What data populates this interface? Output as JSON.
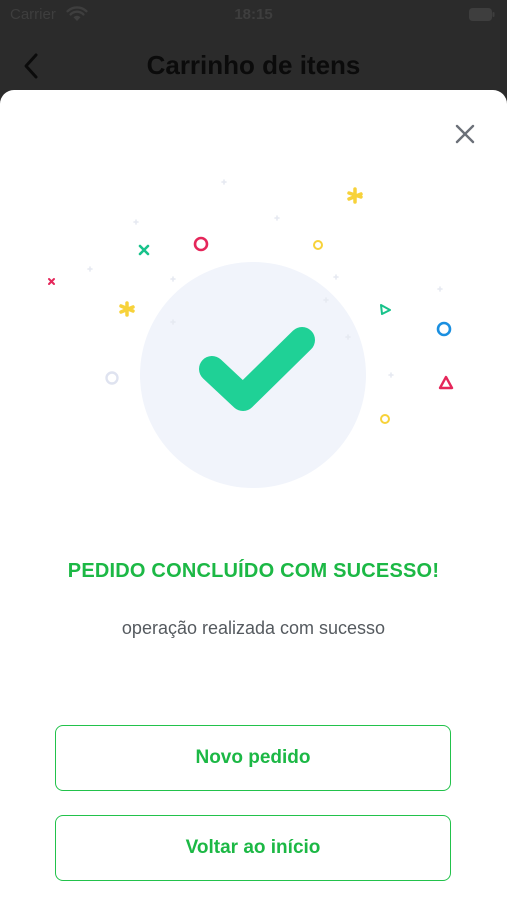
{
  "status_bar": {
    "carrier": "Carrier",
    "time": "18:15"
  },
  "nav": {
    "title": "Carrinho de itens"
  },
  "modal": {
    "title": "PEDIDO CONCLUÍDO COM SUCESSO!",
    "subtitle": "operação realizada com sucesso",
    "buttons": {
      "new_order": "Novo pedido",
      "back_home": "Voltar ao início"
    }
  },
  "colors": {
    "accent_green": "#1cb845",
    "check_green": "#1fd196",
    "circle_bg": "#f1f4fb",
    "confetti_yellow": "#f7d23a",
    "confetti_red": "#e5265a",
    "confetti_blue": "#1a8fe0",
    "confetti_teal": "#17c28a"
  },
  "icons": {
    "back": "chevron-left-icon",
    "close": "close-icon",
    "check": "checkmark-icon",
    "wifi": "wifi-icon",
    "battery": "battery-icon"
  }
}
